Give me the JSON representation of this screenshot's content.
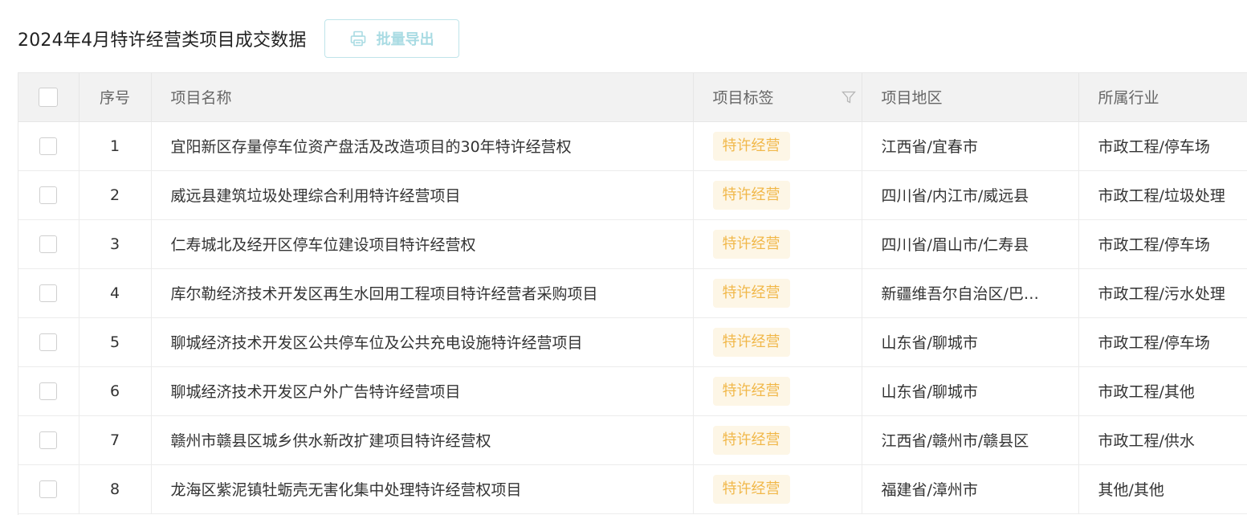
{
  "header": {
    "title": "2024年4月特许经营类项目成交数据",
    "export_label": "批量导出"
  },
  "table": {
    "columns": {
      "seq": "序号",
      "name": "项目名称",
      "tag": "项目标签",
      "region": "项目地区",
      "industry": "所属行业"
    },
    "rows": [
      {
        "seq": "1",
        "name": "宜阳新区存量停车位资产盘活及改造项目的30年特许经营权",
        "tag": "特许经营",
        "region": "江西省/宜春市",
        "industry": "市政工程/停车场"
      },
      {
        "seq": "2",
        "name": "威远县建筑垃圾处理综合利用特许经营项目",
        "tag": "特许经营",
        "region": "四川省/内江市/威远县",
        "industry": "市政工程/垃圾处理"
      },
      {
        "seq": "3",
        "name": "仁寿城北及经开区停车位建设项目特许经营权",
        "tag": "特许经营",
        "region": "四川省/眉山市/仁寿县",
        "industry": "市政工程/停车场"
      },
      {
        "seq": "4",
        "name": "库尔勒经济技术开发区再生水回用工程项目特许经营者采购项目",
        "tag": "特许经营",
        "region": "新疆维吾尔自治区/巴…",
        "industry": "市政工程/污水处理"
      },
      {
        "seq": "5",
        "name": "聊城经济技术开发区公共停车位及公共充电设施特许经营项目",
        "tag": "特许经营",
        "region": "山东省/聊城市",
        "industry": "市政工程/停车场"
      },
      {
        "seq": "6",
        "name": "聊城经济技术开发区户外广告特许经营项目",
        "tag": "特许经营",
        "region": "山东省/聊城市",
        "industry": "市政工程/其他"
      },
      {
        "seq": "7",
        "name": "赣州市赣县区城乡供水新改扩建项目特许经营权",
        "tag": "特许经营",
        "region": "江西省/赣州市/赣县区",
        "industry": "市政工程/供水"
      },
      {
        "seq": "8",
        "name": "龙海区紫泥镇牡蛎壳无害化集中处理特许经营权项目",
        "tag": "特许经营",
        "region": "福建省/漳州市",
        "industry": "其他/其他"
      }
    ]
  },
  "colors": {
    "tag_text": "#f1b84a",
    "tag_bg": "#fdf6e6",
    "export_text": "#a9dbe3",
    "export_border": "#bfe4ea"
  },
  "icons": {
    "export": "printer-icon",
    "filter": "filter-icon"
  }
}
